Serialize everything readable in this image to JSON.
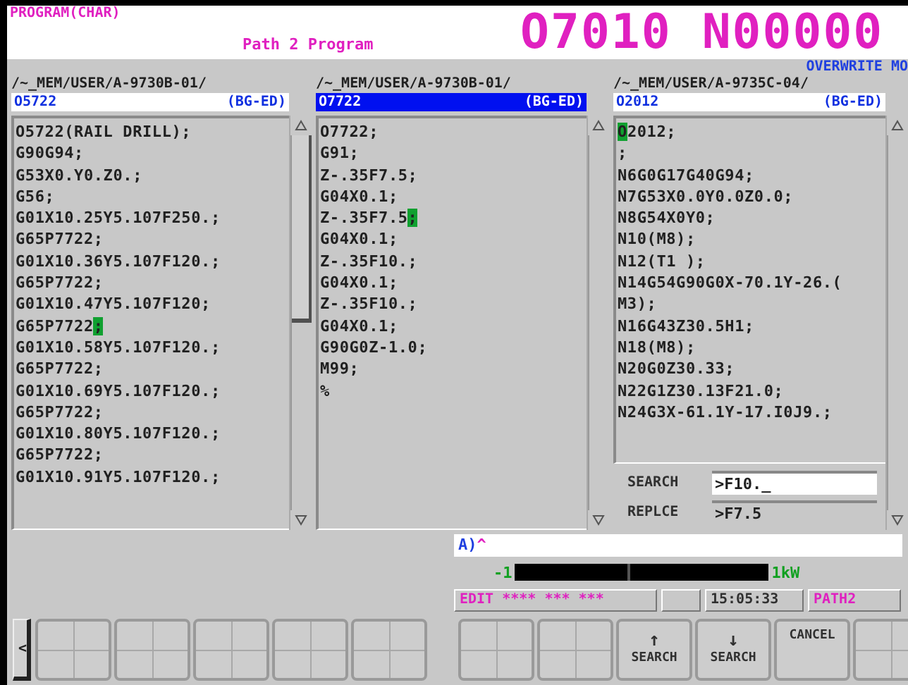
{
  "header": {
    "screen": "PROGRAM(CHAR)",
    "path": "Path 2 Program",
    "program_number": "O7010 N00000",
    "mode": "OVERWRITE MO"
  },
  "panels": [
    {
      "path": "/~_MEM/USER/A-9730B-01/",
      "program": "O5722",
      "tag": "(BG-ED)",
      "selected": false,
      "thumb": true,
      "lines": [
        {
          "text": "O5722(RAIL DRILL);"
        },
        {
          "text": "G90G94;"
        },
        {
          "text": "G53X0.Y0.Z0.;"
        },
        {
          "text": "G56;"
        },
        {
          "text": "G01X10.25Y5.107F250.;"
        },
        {
          "text": "G65P7722;"
        },
        {
          "text": "G01X10.36Y5.107F120.;"
        },
        {
          "text": "G65P7722;"
        },
        {
          "text": "G01X10.47Y5.107F120;"
        },
        {
          "text": "G65P7722",
          "cursor": ";"
        },
        {
          "text": "G01X10.58Y5.107F120.;"
        },
        {
          "text": "G65P7722;"
        },
        {
          "text": "G01X10.69Y5.107F120.;"
        },
        {
          "text": "G65P7722;"
        },
        {
          "text": "G01X10.80Y5.107F120.;"
        },
        {
          "text": "G65P7722;"
        },
        {
          "text": "G01X10.91Y5.107F120.;"
        }
      ]
    },
    {
      "path": "/~_MEM/USER/A-9730B-01/",
      "program": "O7722",
      "tag": "(BG-ED)",
      "selected": true,
      "thumb": false,
      "lines": [
        {
          "text": "O7722;"
        },
        {
          "text": "G91;"
        },
        {
          "text": "Z-.35F7.5;"
        },
        {
          "text": "G04X0.1;"
        },
        {
          "text": "Z-.35F7.5",
          "cursor": ";"
        },
        {
          "text": "G04X0.1;"
        },
        {
          "text": "Z-.35F10.;"
        },
        {
          "text": "G04X0.1;"
        },
        {
          "text": "Z-.35F10.;"
        },
        {
          "text": "G04X0.1;"
        },
        {
          "text": "G90G0Z-1.0;"
        },
        {
          "text": "M99;"
        },
        {
          "text": "%"
        }
      ]
    },
    {
      "path": "/~_MEM/USER/A-9735C-04/",
      "program": "O2012",
      "tag": "(BG-ED)",
      "selected": false,
      "thumb": false,
      "lines": [
        {
          "cursor": "O",
          "after": "2012;"
        },
        {
          "text": ";"
        },
        {
          "text": "N6G0G17G40G94;"
        },
        {
          "text": "N7G53X0.0Y0.0Z0.0;"
        },
        {
          "text": "N8G54X0Y0;"
        },
        {
          "text": "N10(M8);"
        },
        {
          "text": "N12(T1 );"
        },
        {
          "text": "N14G54G90G0X-70.1Y-26.("
        },
        {
          "text": "M3);"
        },
        {
          "text": "N16G43Z30.5H1;"
        },
        {
          "text": "N18(M8);"
        },
        {
          "text": "N20G0Z30.33;"
        },
        {
          "text": "N22G1Z30.13F21.0;"
        },
        {
          "text": "N24G3X-61.1Y-17.I0J9.;"
        }
      ],
      "fields": [
        {
          "label": "SEARCH",
          "value": ">F10._",
          "selected": true
        },
        {
          "label": "REPLCE",
          "value": ">F7.5",
          "selected": false
        }
      ]
    }
  ],
  "input": {
    "prompt": "A)",
    "value": "^"
  },
  "meter": {
    "min": "-1",
    "max": "1kW"
  },
  "status": {
    "mode": "EDIT **** *** ***",
    "time": "15:05:33",
    "path": "PATH2"
  },
  "left_key": "<",
  "softkeys_left": [
    {
      "kind": "blank"
    },
    {
      "kind": "blank"
    },
    {
      "kind": "blank"
    },
    {
      "kind": "blank"
    },
    {
      "kind": "blank"
    }
  ],
  "softkeys_right": [
    {
      "kind": "blank"
    },
    {
      "kind": "blank"
    },
    {
      "kind": "arrow",
      "arrow": "↑",
      "label": "SEARCH"
    },
    {
      "kind": "arrow",
      "arrow": "↓",
      "label": "SEARCH"
    },
    {
      "kind": "text",
      "label": "CANCEL"
    },
    {
      "kind": "blank"
    }
  ]
}
